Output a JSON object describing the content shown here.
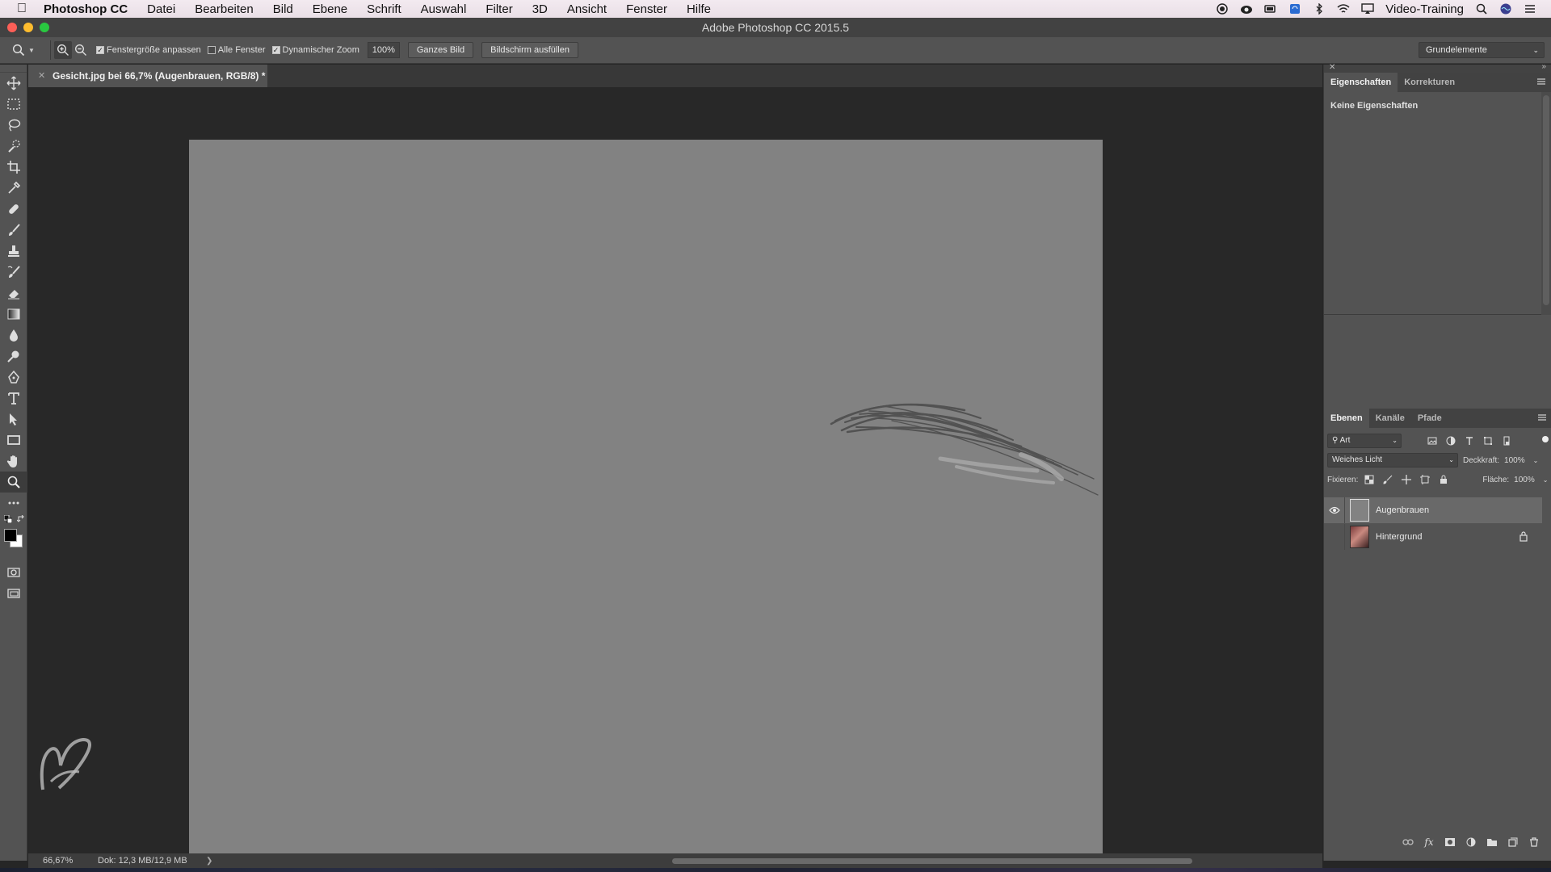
{
  "menubar": {
    "app_name": "Photoshop CC",
    "items": [
      "Datei",
      "Bearbeiten",
      "Bild",
      "Ebene",
      "Schrift",
      "Auswahl",
      "Filter",
      "3D",
      "Ansicht",
      "Fenster",
      "Hilfe"
    ],
    "user": "Video-Training"
  },
  "window": {
    "title": "Adobe Photoshop CC 2015.5"
  },
  "options_bar": {
    "checkboxes": [
      {
        "label": "Fenstergröße anpassen",
        "checked": true
      },
      {
        "label": "Alle Fenster",
        "checked": false
      },
      {
        "label": "Dynamischer Zoom",
        "checked": true
      }
    ],
    "zoom_value": "100%",
    "btn_fit": "Ganzes Bild",
    "btn_fill": "Bildschirm ausfüllen",
    "workspace": "Grundelemente"
  },
  "document": {
    "tab_title": "Gesicht.jpg bei 66,7% (Augenbrauen, RGB/8) *",
    "canvas_color": "#828282"
  },
  "status": {
    "zoom": "66,67%",
    "doc_size": "Dok: 12,3 MB/12,9 MB"
  },
  "properties_panel": {
    "tabs": [
      "Eigenschaften",
      "Korrekturen"
    ],
    "active_tab": 0,
    "body_text": "Keine Eigenschaften"
  },
  "layers_panel": {
    "tabs": [
      "Ebenen",
      "Kanäle",
      "Pfade"
    ],
    "filter_label": "Art",
    "blend_mode": "Weiches Licht",
    "opacity_label": "Deckkraft:",
    "opacity_value": "100%",
    "lock_label": "Fixieren:",
    "fill_label": "Fläche:",
    "fill_value": "100%",
    "layers": [
      {
        "name": "Augenbrauen",
        "selected": true,
        "visible": true,
        "locked": false
      },
      {
        "name": "Hintergrund",
        "selected": false,
        "visible": false,
        "locked": true
      }
    ]
  },
  "colors": {
    "foreground": "#000000",
    "background": "#ffffff",
    "panel": "#535353",
    "canvas_bg": "#282828"
  }
}
